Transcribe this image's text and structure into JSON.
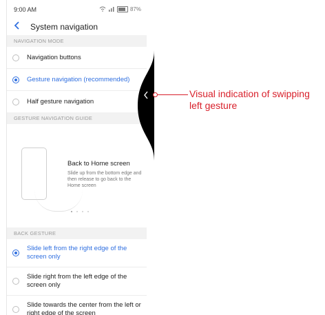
{
  "status_bar": {
    "time": "9:00 AM",
    "battery": "87%"
  },
  "header": {
    "title": "System navigation"
  },
  "navigation_mode": {
    "heading": "NAVIGATION MODE",
    "options": [
      {
        "label": "Navigation buttons",
        "selected": false
      },
      {
        "label": "Gesture navigation (recommended)",
        "selected": true
      },
      {
        "label": "Half gesture navigation",
        "selected": false
      }
    ]
  },
  "guide": {
    "heading": "GESTURE NAVIGATION GUIDE",
    "title": "Back to Home screen",
    "description": "Slide up from the bottom edge and then release to go back to the Home screen",
    "page_count": 4,
    "current_page": 1
  },
  "back_gesture": {
    "heading": "BACK GESTURE",
    "options": [
      {
        "label": "Slide left from the right edge of the screen only",
        "selected": true
      },
      {
        "label": "Slide right from the left edge of the screen only",
        "selected": false
      },
      {
        "label": "Slide towards the center from the left or right edge of the screen",
        "selected": false
      }
    ]
  },
  "annotation": {
    "text": "Visual indication of swipping left gesture"
  },
  "colors": {
    "accent": "#2f6fe0",
    "annotation": "#d81f2a"
  }
}
